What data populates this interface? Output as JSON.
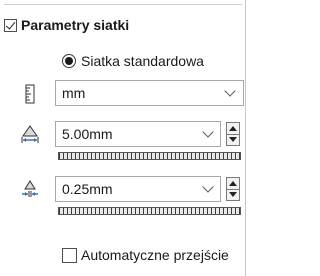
{
  "section": {
    "title": "Parametry siatki",
    "enabled": true
  },
  "grid_type": {
    "selected_label": "Siatka standardowa",
    "selected": true
  },
  "units": {
    "icon": "ruler-icon",
    "value": "mm"
  },
  "global_size": {
    "icon": "global-element-size-icon",
    "value": "5.00mm"
  },
  "tolerance": {
    "icon": "tolerance-icon",
    "value": "0.25mm"
  },
  "auto_transition": {
    "label": "Automatyczne przejście",
    "checked": false
  },
  "colors": {
    "border": "#a8a8a8",
    "text": "#1a1a1a",
    "icon_blue": "#3f6fb5"
  }
}
